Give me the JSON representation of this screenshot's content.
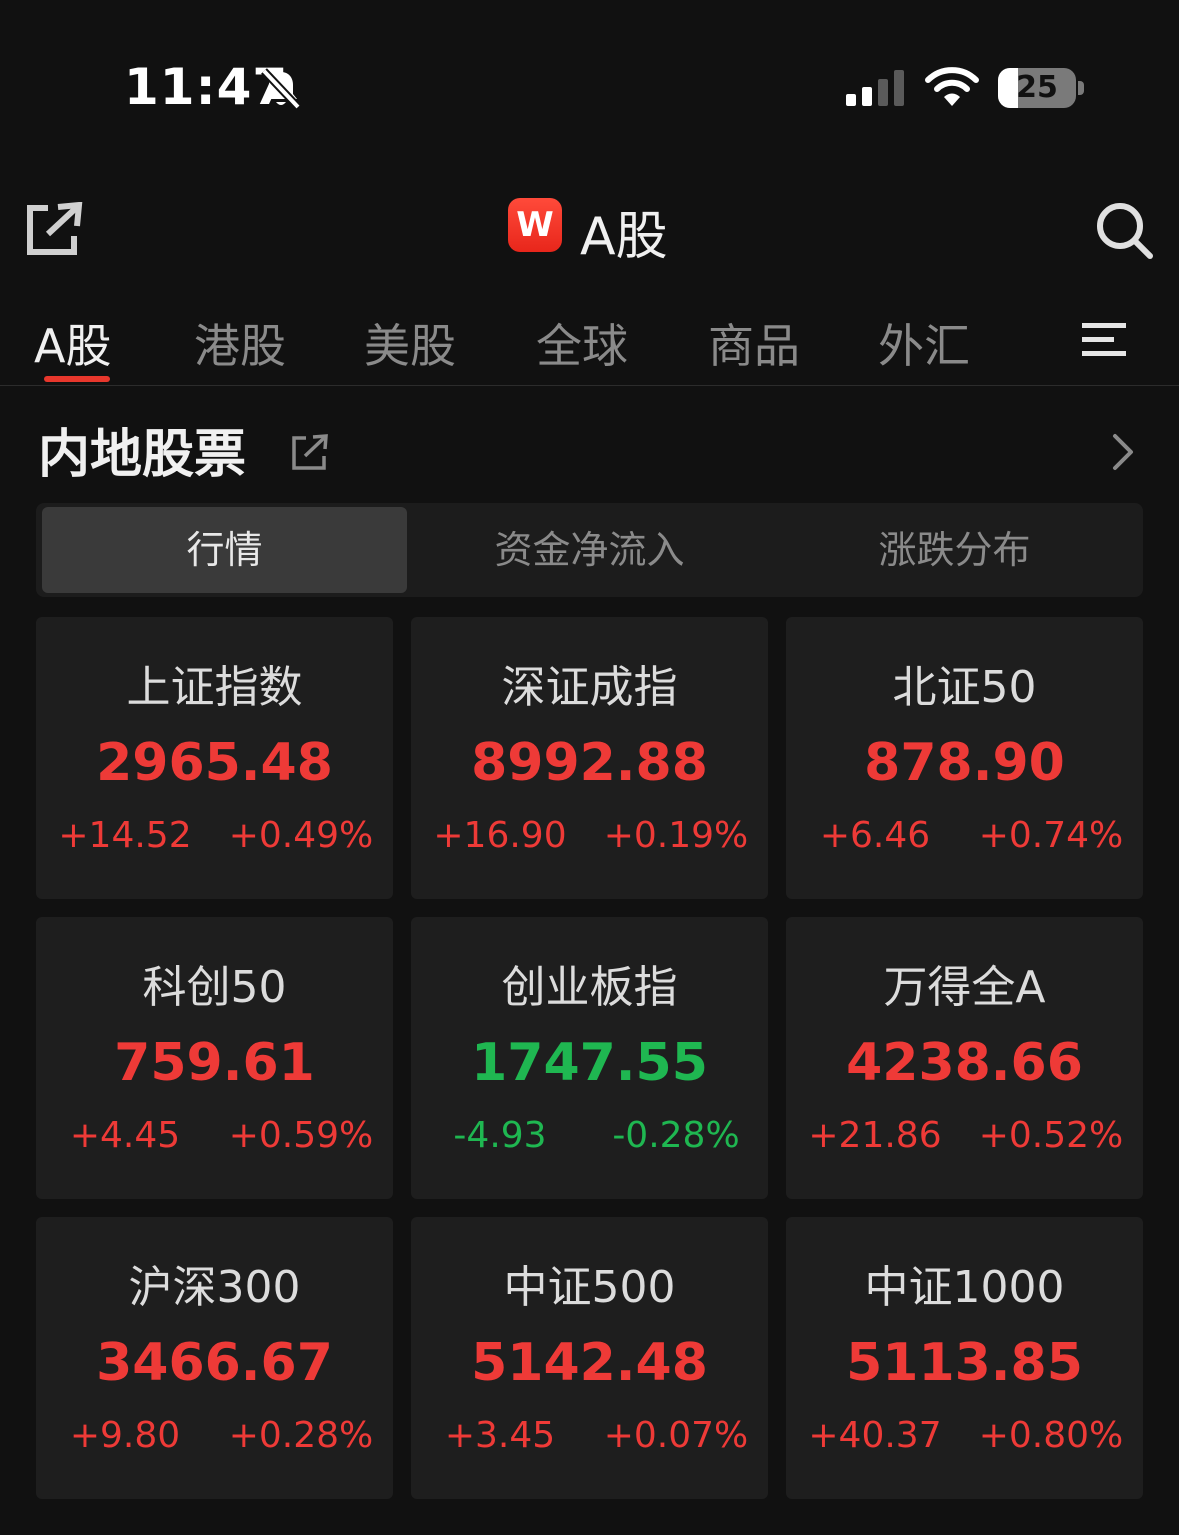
{
  "status_bar": {
    "time": "11:47",
    "battery": "25",
    "battery_level": 0.25
  },
  "header": {
    "logo": "W",
    "title": "A股"
  },
  "tabs": [
    {
      "label": "A股",
      "active": true
    },
    {
      "label": "港股",
      "active": false
    },
    {
      "label": "美股",
      "active": false
    },
    {
      "label": "全球",
      "active": false
    },
    {
      "label": "商品",
      "active": false
    },
    {
      "label": "外汇",
      "active": false
    }
  ],
  "section": {
    "title": "内地股票"
  },
  "segments": [
    {
      "label": "行情",
      "active": true
    },
    {
      "label": "资金净流入",
      "active": false
    },
    {
      "label": "涨跌分布",
      "active": false
    }
  ],
  "colors": {
    "up": "#ee3a37",
    "down": "#1fb751",
    "accent": "#e8372c"
  },
  "indices": [
    {
      "name": "上证指数",
      "value": "2965.48",
      "change": "+14.52",
      "pct": "+0.49%",
      "trend": "up"
    },
    {
      "name": "深证成指",
      "value": "8992.88",
      "change": "+16.90",
      "pct": "+0.19%",
      "trend": "up"
    },
    {
      "name": "北证50",
      "value": "878.90",
      "change": "+6.46",
      "pct": "+0.74%",
      "trend": "up"
    },
    {
      "name": "科创50",
      "value": "759.61",
      "change": "+4.45",
      "pct": "+0.59%",
      "trend": "up"
    },
    {
      "name": "创业板指",
      "value": "1747.55",
      "change": "-4.93",
      "pct": "-0.28%",
      "trend": "down"
    },
    {
      "name": "万得全A",
      "value": "4238.66",
      "change": "+21.86",
      "pct": "+0.52%",
      "trend": "up"
    },
    {
      "name": "沪深300",
      "value": "3466.67",
      "change": "+9.80",
      "pct": "+0.28%",
      "trend": "up"
    },
    {
      "name": "中证500",
      "value": "5142.48",
      "change": "+3.45",
      "pct": "+0.07%",
      "trend": "up"
    },
    {
      "name": "中证1000",
      "value": "5113.85",
      "change": "+40.37",
      "pct": "+0.80%",
      "trend": "up"
    }
  ]
}
